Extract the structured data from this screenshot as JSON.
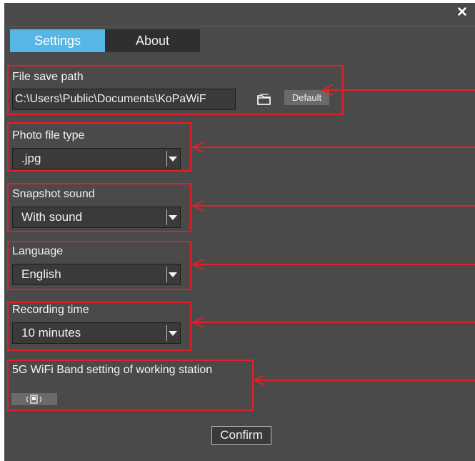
{
  "window": {
    "close_glyph": "✕"
  },
  "tabs": [
    {
      "label": "Settings"
    },
    {
      "label": "About"
    }
  ],
  "file_save_path": {
    "label": "File save path",
    "value": "C:\\Users\\Public\\Documents\\KoPaWiF",
    "folder_icon": "folder-icon",
    "default_label": "Default"
  },
  "photo_file_type": {
    "label": "Photo file type",
    "selected": ".jpg"
  },
  "snapshot_sound": {
    "label": "Snapshot sound",
    "selected": "With sound"
  },
  "language": {
    "label": "Language",
    "selected": "English"
  },
  "recording_time": {
    "label": "Recording time",
    "selected": "10 minutes"
  },
  "wifi_band": {
    "label": "5G WiFi Band setting of working station",
    "icon": "wifi-band-icon"
  },
  "confirm_label": "Confirm",
  "colors": {
    "background": "#4a4a4a",
    "active_tab": "#56b6e6",
    "inactive_tab": "#2f2f2f",
    "annotation": "#e0202a"
  }
}
